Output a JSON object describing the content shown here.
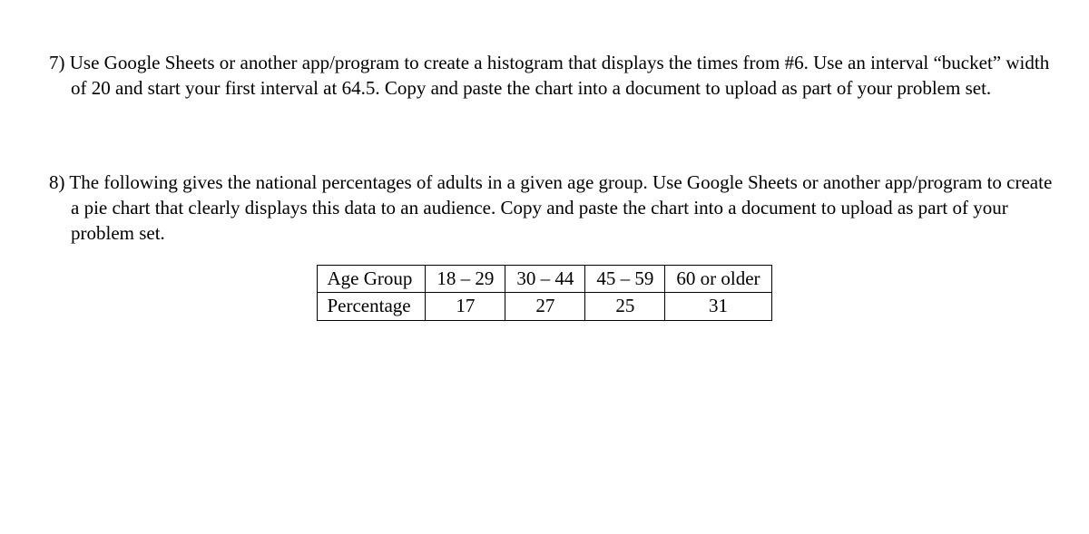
{
  "q7": {
    "number": "7)",
    "text": "Use Google Sheets or another app/program to create a histogram that displays the times from #6. Use an interval “bucket” width of 20 and start your first interval at 64.5.  Copy and paste the chart into a document to upload as part of your problem set."
  },
  "q8": {
    "number": "8)",
    "text": "The following gives the national percentages of adults in a given age group.  Use Google Sheets or another app/program to create a pie chart that clearly displays this data to an audience. Copy and paste the chart into a document to upload as part of your problem set."
  },
  "table": {
    "row1_label": "Age Group",
    "row2_label": "Percentage",
    "c1_h": "18 – 29",
    "c2_h": "30 – 44",
    "c3_h": "45 – 59",
    "c4_h": "60 or older",
    "c1_v": "17",
    "c2_v": "27",
    "c3_v": "25",
    "c4_v": "31"
  },
  "chart_data": {
    "type": "table",
    "description": "National percentages of adults by age group (intended for pie chart)",
    "categories": [
      "18 – 29",
      "30 – 44",
      "45 – 59",
      "60 or older"
    ],
    "values": [
      17,
      27,
      25,
      31
    ],
    "unit": "percent"
  }
}
